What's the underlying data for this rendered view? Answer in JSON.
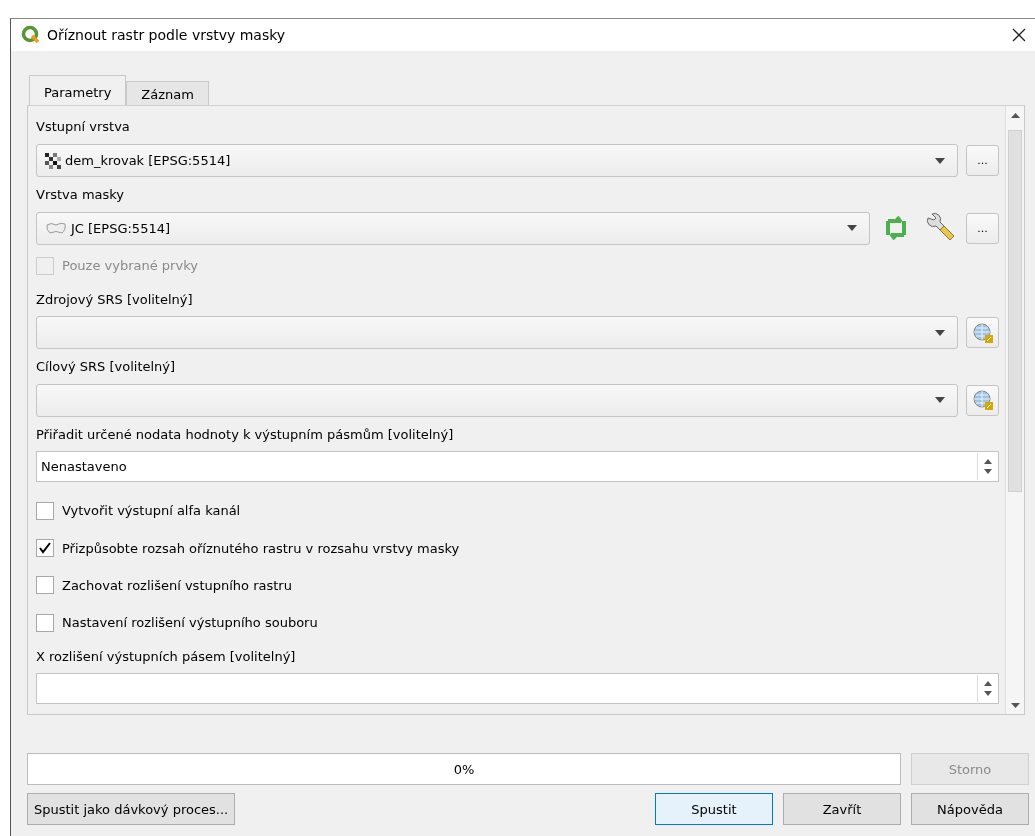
{
  "window": {
    "title": "Oříznout rastr podle vrstvy masky"
  },
  "tabs": [
    {
      "label": "Parametry",
      "selected": true
    },
    {
      "label": "Záznam",
      "selected": false
    }
  ],
  "params": [
    {
      "kind": "label",
      "text": "Vstupní vrstva"
    },
    {
      "kind": "raster_combo",
      "value": "dem_krovak [EPSG:5514]",
      "button": "..."
    },
    {
      "kind": "label",
      "text": "Vrstva masky"
    },
    {
      "kind": "vector_combo",
      "value": "JC [EPSG:5514]",
      "button": "..."
    },
    {
      "kind": "checkbox",
      "text": "Pouze vybrané prvky",
      "checked": false,
      "disabled": true
    },
    {
      "kind": "label",
      "text": "Zdrojový SRS [volitelný]"
    },
    {
      "kind": "crs_combo"
    },
    {
      "kind": "label",
      "text": "Cílový SRS [volitelný]"
    },
    {
      "kind": "crs_combo"
    },
    {
      "kind": "label",
      "text": "Přiřadit určené nodata hodnoty k výstupním pásmům [volitelný]"
    },
    {
      "kind": "spin",
      "value": "Nenastaveno"
    },
    {
      "kind": "checkbox",
      "text": "Vytvořit výstupní alfa kanál",
      "checked": false,
      "disabled": false
    },
    {
      "kind": "checkbox",
      "text": "Přizpůsobte rozsah oříznutého rastru v rozsahu vrstvy masky",
      "checked": true,
      "disabled": false
    },
    {
      "kind": "checkbox",
      "text": "Zachovat rozlišení vstupního rastru",
      "checked": false,
      "disabled": false
    },
    {
      "kind": "checkbox",
      "text": "Nastavení rozlišení výstupního souboru",
      "checked": false,
      "disabled": false
    },
    {
      "kind": "label",
      "text": "X rozlišení výstupních pásem [volitelný]"
    },
    {
      "kind": "spin"
    }
  ],
  "progress": {
    "text": "0%",
    "level": 0
  },
  "cancel_button": {
    "label": "Storno",
    "disabled": true
  },
  "batch_button": {
    "label": "Spustit jako dávkový proces..."
  },
  "buttons": [
    {
      "label": "Spustit",
      "default": true
    },
    {
      "label": "Zavřít",
      "default": false
    },
    {
      "label": "Nápověda",
      "default": false
    }
  ]
}
